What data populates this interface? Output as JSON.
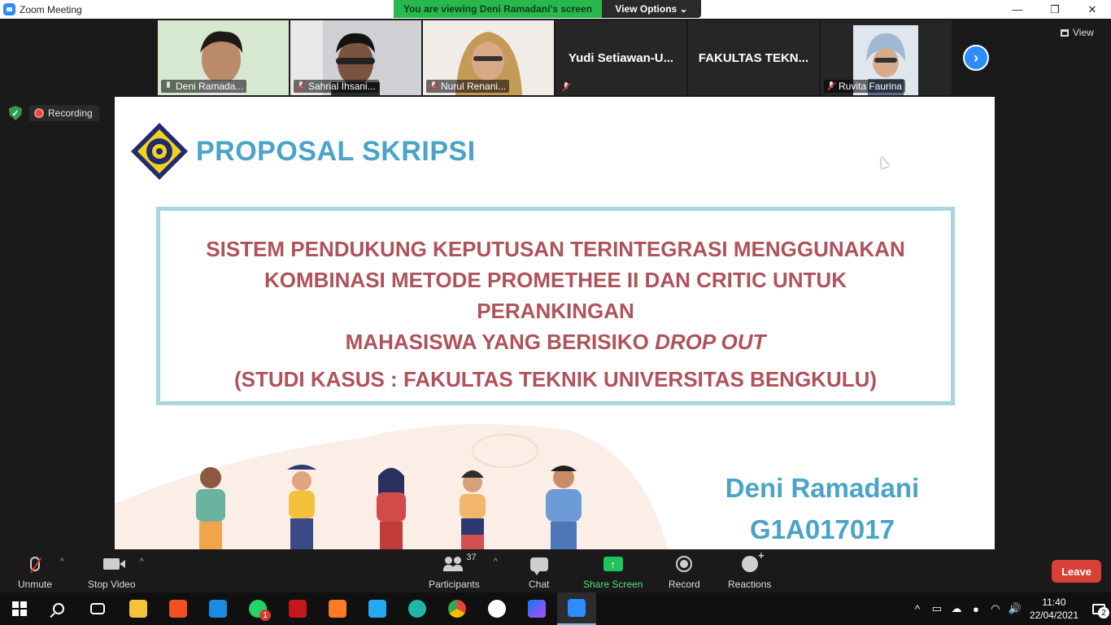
{
  "window": {
    "title": "Zoom Meeting",
    "minimize_glyph": "—",
    "restore_glyph": "❐",
    "close_glyph": "✕"
  },
  "banner": {
    "viewing_text": "You are viewing Deni Ramadani's screen",
    "view_options_label": "View Options ⌄"
  },
  "gallery": {
    "participants": [
      {
        "name": "Deni Ramada...",
        "muted": false,
        "pinned": true
      },
      {
        "name": "Sahrial Ihsani...",
        "muted": true
      },
      {
        "name": "Nurul Renani...",
        "muted": true
      },
      {
        "name": "Yudi  Setiawan-U...",
        "muted": true,
        "video_off": true
      },
      {
        "name": "FAKULTAS TEKN...",
        "video_off": true
      },
      {
        "name": "Ruvita Faurina",
        "muted": true
      }
    ],
    "next_glyph": "›",
    "view_label": "View"
  },
  "status": {
    "recording_label": "Recording"
  },
  "slide": {
    "heading": "PROPOSAL SKRIPSI",
    "title_lines": [
      "SISTEM PENDUKUNG KEPUTUSAN TERINTEGRASI MENGGUNAKAN",
      "KOMBINASI METODE PROMETHEE II DAN CRITIC UNTUK PERANKINGAN",
      "MAHASISWA YANG BERISIKO"
    ],
    "title_italic": "DROP OUT",
    "subtitle": "(STUDI KASUS : FAKULTAS TEKNIK UNIVERSITAS BENGKULU)",
    "author": "Deni Ramadani",
    "student_id": "G1A017017"
  },
  "toolbar": {
    "unmute": "Unmute",
    "stop_video": "Stop Video",
    "participants": "Participants",
    "participants_count": "37",
    "chat": "Chat",
    "share_screen": "Share Screen",
    "share_glyph": "↑",
    "record": "Record",
    "reactions": "Reactions",
    "leave": "Leave",
    "caret_glyph": "^"
  },
  "taskbar": {
    "whatsapp_badge": "1",
    "time": "11:40",
    "date": "22/04/2021",
    "notifications_count": "2",
    "tray_up_glyph": "^",
    "volume_glyph": "🔊"
  },
  "colors": {
    "accent_blue": "#2d8cff",
    "banner_green": "#29b84c",
    "slide_title_blue": "#4aa3c8",
    "slide_text_red": "#b0525a",
    "leave_red": "#d8403a"
  }
}
